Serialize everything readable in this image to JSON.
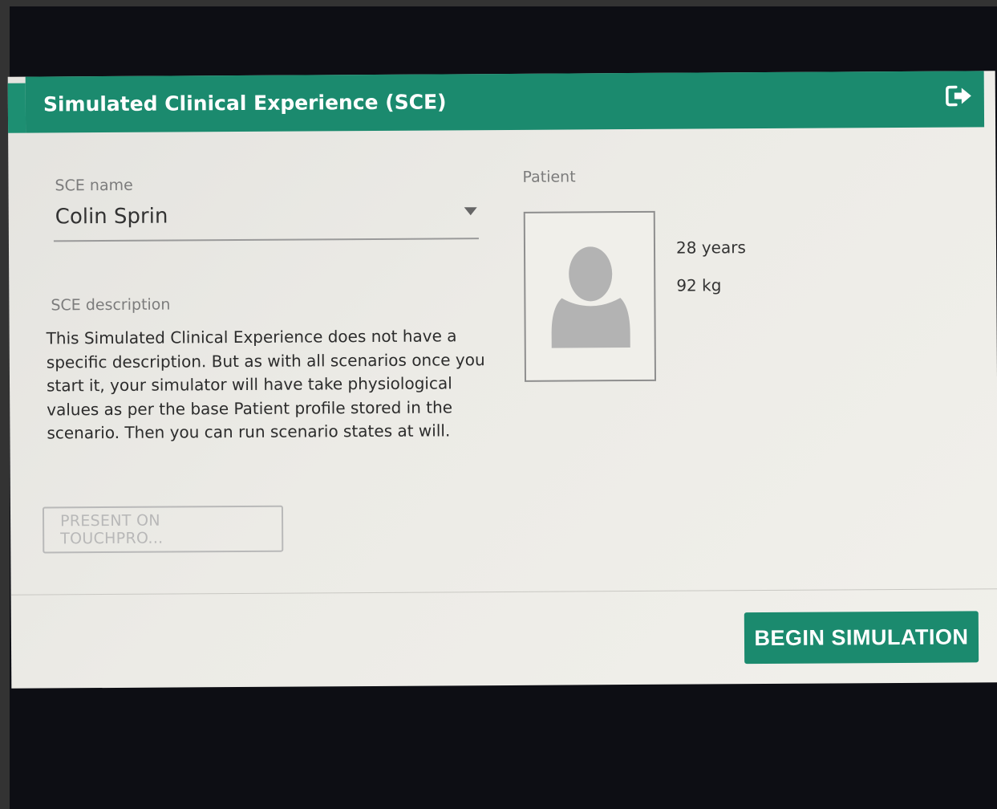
{
  "header": {
    "title": "Simulated Clinical Experience (SCE)",
    "exit_icon": "sign-out-icon"
  },
  "form": {
    "sce_name_label": "SCE name",
    "sce_name_value": "Colin Sprin",
    "sce_description_label": "SCE description",
    "sce_description_text": "This Simulated Clinical Experience does not have a specific description. But as with all scenarios once you start it, your simulator will have take physiological values as per the base Patient profile stored in the scenario. Then you can run scenario states at will."
  },
  "patient": {
    "label": "Patient",
    "age": "28 years",
    "weight": "92 kg",
    "avatar_icon": "user-silhouette-icon"
  },
  "actions": {
    "present_label": "PRESENT ON TOUCHPRO...",
    "begin_label": "BEGIN SIMULATION"
  },
  "colors": {
    "accent": "#1b8a6e",
    "panel": "#ecebe6",
    "background": "#0d0e14"
  }
}
